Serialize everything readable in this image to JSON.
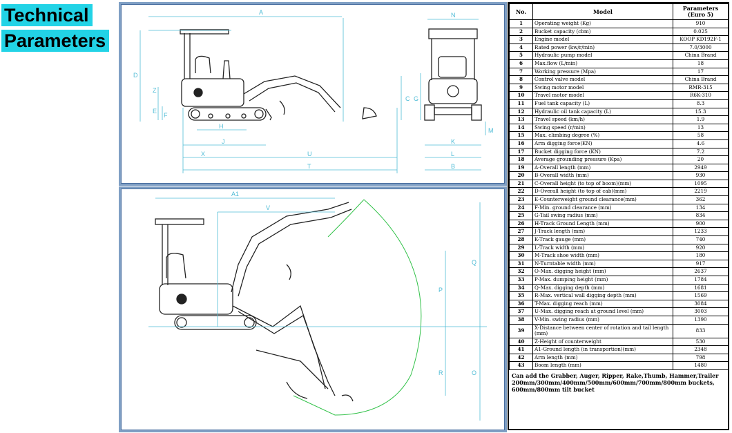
{
  "heading": {
    "line1": "Technical",
    "line2": "Parameters"
  },
  "dimension_labels": {
    "top_side": [
      "A",
      "D",
      "C",
      "Z",
      "E",
      "F",
      "H",
      "J",
      "X",
      "U",
      "T"
    ],
    "top_front": [
      "N",
      "G",
      "M",
      "K",
      "L",
      "B"
    ],
    "bottom": [
      "A1",
      "V",
      "Q",
      "P",
      "R",
      "O"
    ]
  },
  "colors": {
    "title_bg": "#22d3e6",
    "panel_border": "#7f9fc4",
    "dimension_line": "#4fbcd6",
    "reach_arc": "#33c24a"
  },
  "table": {
    "headers": {
      "no": "No.",
      "model": "Model",
      "params": "Parameters (Euro 5)"
    },
    "rows": [
      {
        "no": "1",
        "name": "Operating weight (Kg)",
        "value": "910"
      },
      {
        "no": "2",
        "name": "Bucket capacity (cbm)",
        "value": "0.025"
      },
      {
        "no": "3",
        "name": "Engine model",
        "value": "KOOP KD192F-1"
      },
      {
        "no": "4",
        "name": "Rated power (kw/r/min)",
        "value": "7.0/3000"
      },
      {
        "no": "5",
        "name": "Hydraulic pump model",
        "value": "China Brand"
      },
      {
        "no": "6",
        "name": "Max.flow (L/min)",
        "value": "18"
      },
      {
        "no": "7",
        "name": "Working pressure (Mpa)",
        "value": "17"
      },
      {
        "no": "8",
        "name": "Control valve model",
        "value": "China Brand"
      },
      {
        "no": "9",
        "name": "Swing motor model",
        "value": "RMR-315"
      },
      {
        "no": "10",
        "name": "Travel motor model",
        "value": "R6K-310"
      },
      {
        "no": "11",
        "name": "Fuel tank capacity (L)",
        "value": "8.3"
      },
      {
        "no": "12",
        "name": "Hydraulic oil tank capacity (L)",
        "value": "15.3"
      },
      {
        "no": "13",
        "name": "Travel speed (km/h)",
        "value": "1.9"
      },
      {
        "no": "14",
        "name": "Swing speed (r/min)",
        "value": "13"
      },
      {
        "no": "15",
        "name": "Max. climbing degree (%)",
        "value": "58"
      },
      {
        "no": "16",
        "name": "Arm digging force(KN)",
        "value": "4.6"
      },
      {
        "no": "17",
        "name": "Bucket digging force (KN)",
        "value": "7.2"
      },
      {
        "no": "18",
        "name": "Average grounding pressure (Kpa)",
        "value": "20"
      },
      {
        "no": "19",
        "name": "A-Overall length (mm)",
        "value": "2949"
      },
      {
        "no": "20",
        "name": "B-Overall width (mm)",
        "value": "930"
      },
      {
        "no": "21",
        "name": "C-Overall height (to top of boom)(mm)",
        "value": "1095"
      },
      {
        "no": "22",
        "name": "D-Overall height (to top of cab)(mm)",
        "value": "2219"
      },
      {
        "no": "23",
        "name": "E-Counterweight ground clearance(mm)",
        "value": "362"
      },
      {
        "no": "24",
        "name": "F-Min. ground clearance (mm)",
        "value": "134"
      },
      {
        "no": "25",
        "name": "G-Tail swing radius (mm)",
        "value": "834"
      },
      {
        "no": "26",
        "name": "H-Track Ground Length (mm)",
        "value": "900"
      },
      {
        "no": "27",
        "name": "J-Track length (mm)",
        "value": "1233"
      },
      {
        "no": "28",
        "name": "K-Track gauge (mm)",
        "value": "740"
      },
      {
        "no": "29",
        "name": "L-Track width (mm)",
        "value": "920"
      },
      {
        "no": "30",
        "name": "M-Track shoe width (mm)",
        "value": "180"
      },
      {
        "no": "31",
        "name": "N-Turntable width (mm)",
        "value": "917"
      },
      {
        "no": "32",
        "name": "O-Max. digging height (mm)",
        "value": "2637"
      },
      {
        "no": "33",
        "name": "P-Max. dumping height (mm)",
        "value": "1784"
      },
      {
        "no": "34",
        "name": "Q-Max. digging depth (mm)",
        "value": "1681"
      },
      {
        "no": "35",
        "name": "R-Max. vertical wall digging depth (mm)",
        "value": "1569"
      },
      {
        "no": "36",
        "name": "T-Max. digging reach (mm)",
        "value": "3084"
      },
      {
        "no": "37",
        "name": "U-Max. digging reach at ground level (mm)",
        "value": "3003"
      },
      {
        "no": "38",
        "name": "V-Min. swing radius (mm)",
        "value": "1390"
      },
      {
        "no": "39",
        "name": "X-Distance between center of rotation and tail length (mm)",
        "value": "833"
      },
      {
        "no": "40",
        "name": "Z-Height of counterweight",
        "value": "530"
      },
      {
        "no": "41",
        "name": "A1-Ground length (in transportion)(mm)",
        "value": "2348"
      },
      {
        "no": "42",
        "name": "Arm length (mm)",
        "value": "798"
      },
      {
        "no": "43",
        "name": "Boom length (mm)",
        "value": "1480"
      }
    ],
    "note": "Can add the Grabber, Auger, Ripper, Rake,Thumb, Hammer,Trailer 200mm/300mm/400mm/500mm/600mm/700mm/800mm buckets, 600mm/800mm tilt bucket"
  }
}
